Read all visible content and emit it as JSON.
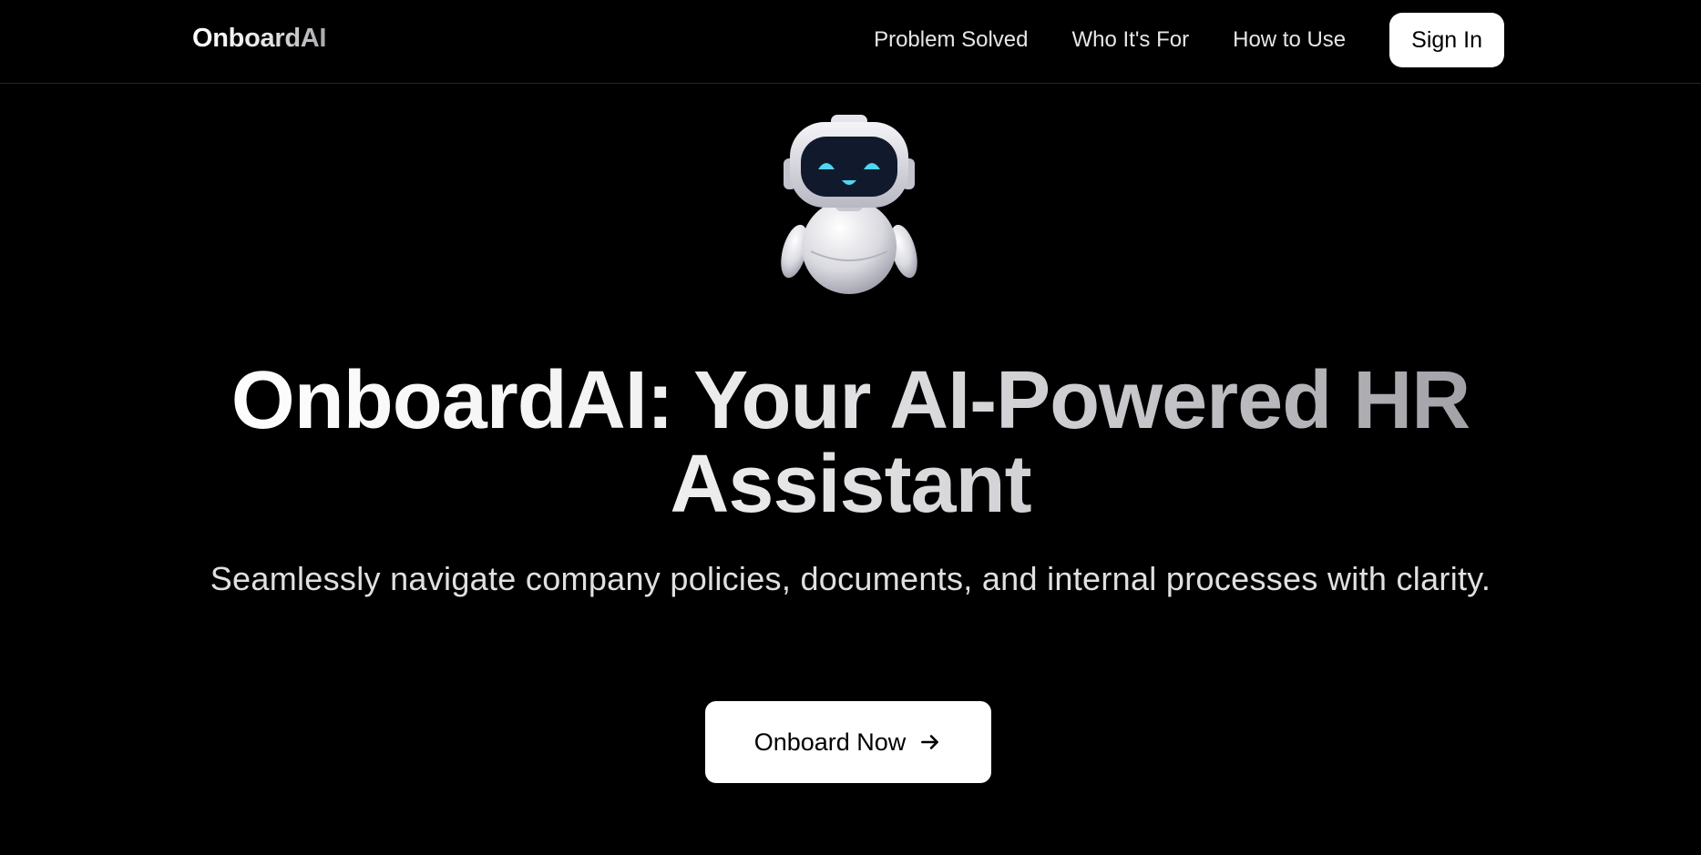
{
  "nav": {
    "brand": "OnboardAI",
    "links": [
      "Problem Solved",
      "Who It's For",
      "How to Use"
    ],
    "sign_in": "Sign In"
  },
  "hero": {
    "mascot_icon": "robot-mascot-icon",
    "headline_line1": "OnboardAI: Your AI-Powered HR",
    "headline_line2": "Assistant",
    "subtitle": "Seamlessly navigate company policies, documents, and internal processes with clarity.",
    "cta_label": "Onboard Now",
    "cta_icon": "arrow-right-icon"
  },
  "colors": {
    "background": "#000000",
    "button_bg": "#ffffff",
    "button_text": "#000000",
    "robot_eye": "#4fd6f0"
  }
}
